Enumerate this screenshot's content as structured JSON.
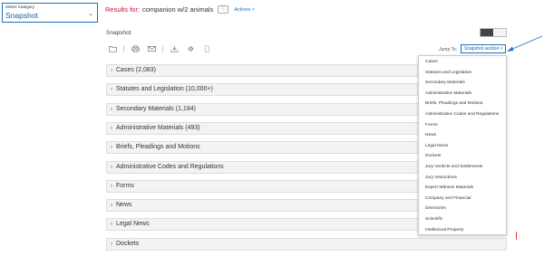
{
  "category_select": {
    "label": "Select Category",
    "value": "Snapshot"
  },
  "results": {
    "prefix": "Results for:",
    "query": "companion w/2 animals",
    "actions_label": "Actions"
  },
  "snapshot": {
    "title": "Snapshot"
  },
  "jump_to": {
    "label": "Jump To:",
    "selected": "Snapshot section"
  },
  "sections": [
    "Cases (2,083)",
    "Statutes and Legislation (10,000+)",
    "Secondary Materials (1,184)",
    "Administrative Materials (493)",
    "Briefs, Pleadings and Motions",
    "Administrative Codes and Regulations",
    "Forms",
    "News",
    "Legal News",
    "Dockets"
  ],
  "dropdown_items": [
    "Cases",
    "Statutes and Legislation",
    "Secondary Materials",
    "Administrative Materials",
    "Briefs, Pleadings and Motions",
    "Administrative Codes and Regulations",
    "Forms",
    "News",
    "Legal News",
    "Dockets",
    "Jury Verdicts and Settlements",
    "Jury Instructions",
    "Expert Witness Materials",
    "Company and Financial",
    "Directories",
    "Scientific",
    "Intellectual Property"
  ],
  "icons": [
    "folder-icon",
    "print-icon",
    "email-icon",
    "download-icon",
    "settings-icon",
    "document-icon"
  ],
  "colors": {
    "accent": "#1b6ec2",
    "results_label": "#c8102e"
  }
}
